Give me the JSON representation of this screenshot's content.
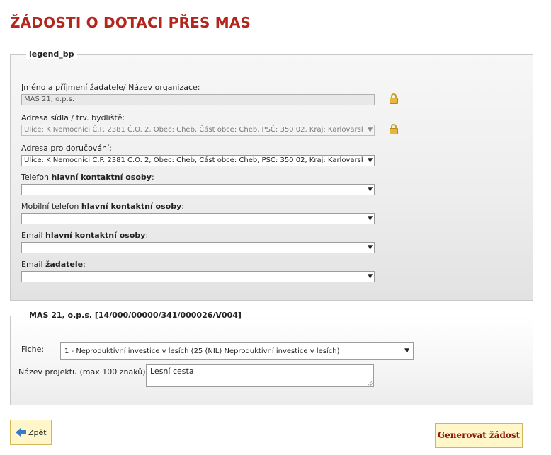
{
  "page": {
    "title": "ŽÁDOSTI O DOTACI PŘES MAS"
  },
  "applicant_section": {
    "legend": "legend_bp",
    "name": {
      "label": "Jméno a příjmení žadatele/ Název organizace:",
      "value": "MAS 21, o.p.s."
    },
    "address": {
      "label": "Adresa sídla / trv. bydliště:",
      "value": "Ulice: K Nemocnici Č.P. 2381 Č.O. 2, Obec: Cheb, Část obce: Cheb, PSČ: 350 02, Kraj: Karlovarský"
    },
    "delivery_address": {
      "label": "Adresa pro doručování:",
      "value": "Ulice: K Nemocnici Č.P. 2381 Č.O. 2, Obec: Cheb, Část obce: Cheb, PSČ: 350 02, Kraj: Karlovarský"
    },
    "phone": {
      "label_prefix": "Telefon ",
      "label_bold": "hlavní kontaktní osoby",
      "label_suffix": ":",
      "value": ""
    },
    "mobile": {
      "label_prefix": "Mobilní telefon ",
      "label_bold": "hlavní kontaktní osoby",
      "label_suffix": ":",
      "value": ""
    },
    "email_contact": {
      "label_prefix": "Email ",
      "label_bold": "hlavní kontaktní osoby",
      "label_suffix": ":",
      "value": ""
    },
    "email_applicant": {
      "label_prefix": "Email ",
      "label_bold": "žadatele",
      "label_suffix": ":",
      "value": ""
    }
  },
  "mas_section": {
    "legend": "MAS 21, o.p.s. [14/000/00000/341/000026/V004]",
    "fiche": {
      "label": "Fiche:",
      "value": "1 - Neproduktivní investice v lesích (25 (NIL) Neproduktivní investice v lesích)"
    },
    "project_name": {
      "label": "Název projektu (max 100 znaků)",
      "value": "Lesní cesta"
    }
  },
  "buttons": {
    "back": "Zpět",
    "generate": "Generovat žádost"
  },
  "icons": {
    "lock": "lock-icon",
    "back": "arrow-left-icon",
    "caret": "caret-down-icon"
  },
  "colors": {
    "title": "#b3261e",
    "button_bg": "#fff6c9",
    "button_border": "#d3b65a",
    "generate_text": "#8b1a10"
  }
}
